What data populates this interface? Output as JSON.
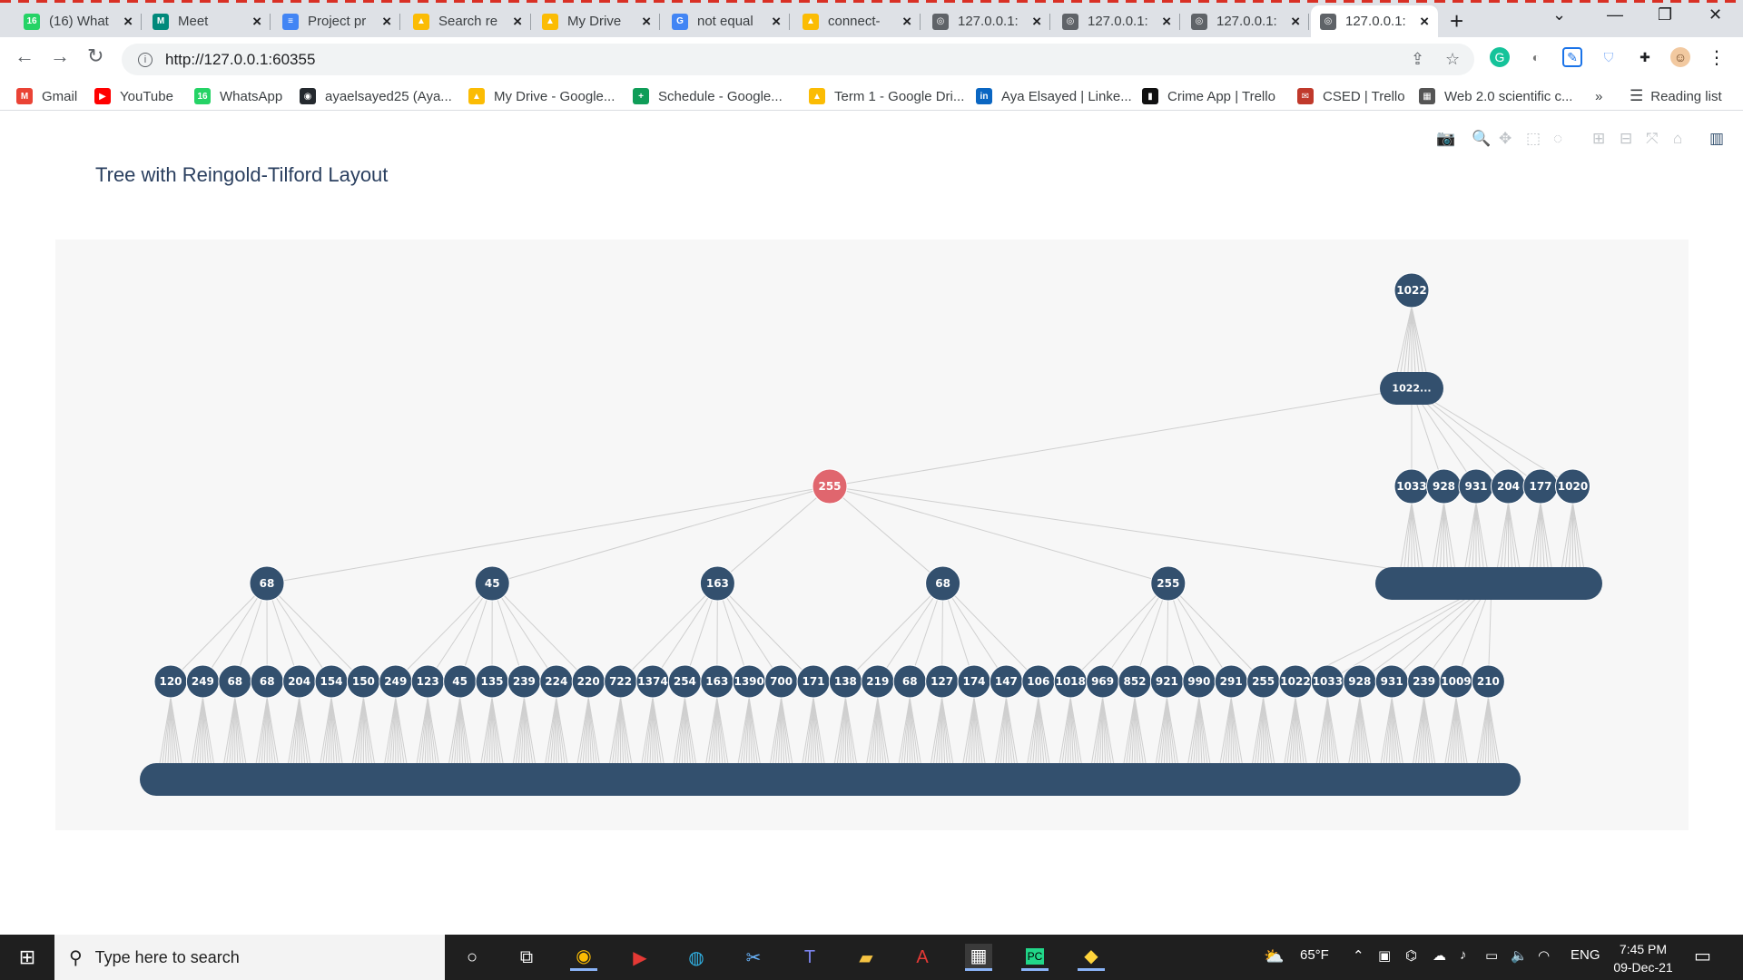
{
  "browser": {
    "tabs": [
      {
        "label": "(16) What",
        "color": "#25d366",
        "glyph": "16"
      },
      {
        "label": "Meet",
        "color": "#00897b",
        "glyph": "M"
      },
      {
        "label": "Project pr",
        "color": "#4285f4",
        "glyph": "≡"
      },
      {
        "label": "Search re",
        "color": "#fbbc04",
        "glyph": "▲"
      },
      {
        "label": "My Drive",
        "color": "#fbbc04",
        "glyph": "▲"
      },
      {
        "label": "not equal",
        "color": "#4285f4",
        "glyph": "G"
      },
      {
        "label": "connect-",
        "color": "#fbbc04",
        "glyph": "▲"
      },
      {
        "label": "127.0.0.1:",
        "color": "#5f6368",
        "glyph": "◎"
      },
      {
        "label": "127.0.0.1:",
        "color": "#5f6368",
        "glyph": "◎"
      },
      {
        "label": "127.0.0.1:",
        "color": "#5f6368",
        "glyph": "◎"
      },
      {
        "label": "127.0.0.1:",
        "color": "#5f6368",
        "glyph": "◎"
      }
    ],
    "url": "http://127.0.0.1:60355",
    "bookmarks": [
      {
        "label": "Gmail",
        "color": "#ea4335",
        "glyph": "M"
      },
      {
        "label": "YouTube",
        "color": "#ff0000",
        "glyph": "▶"
      },
      {
        "label": "WhatsApp",
        "color": "#25d366",
        "glyph": "16"
      },
      {
        "label": "ayaelsayed25 (Aya...",
        "color": "#24292e",
        "glyph": "◉"
      },
      {
        "label": "My Drive - Google...",
        "color": "#fbbc04",
        "glyph": "▲"
      },
      {
        "label": "Schedule - Google...",
        "color": "#0f9d58",
        "glyph": "+"
      },
      {
        "label": "Term 1 - Google Dri...",
        "color": "#fbbc04",
        "glyph": "▲"
      },
      {
        "label": "Aya Elsayed | Linke...",
        "color": "#0a66c2",
        "glyph": "in"
      },
      {
        "label": "Crime App | Trello",
        "color": "#111111",
        "glyph": "▮"
      },
      {
        "label": "CSED | Trello",
        "color": "#c0392b",
        "glyph": "✉"
      },
      {
        "label": "Web 2.0 scientific c...",
        "color": "#555555",
        "glyph": "▦"
      }
    ],
    "more": "»",
    "reading_list": "Reading list"
  },
  "plot": {
    "title": "Tree with Reingold-Tilford Layout",
    "root": {
      "label": "1022",
      "color": "#33506e"
    },
    "cluster_label": "1022... ",
    "center": {
      "label": "255",
      "color": "#e0666e"
    },
    "right_children": [
      "1033",
      "928",
      "931",
      "204",
      "177",
      "1020"
    ],
    "level3": [
      "68",
      "45",
      "163",
      "68",
      "255"
    ],
    "level4": [
      "120",
      "249",
      "68",
      "68",
      "204",
      "154",
      "150",
      "249",
      "123",
      "45",
      "135",
      "239",
      "224",
      "220",
      "722",
      "1374",
      "254",
      "163",
      "1390",
      "700",
      "171",
      "138",
      "219",
      "68",
      "127",
      "174",
      "147",
      "106",
      "1018",
      "969",
      "852",
      "921",
      "990",
      "291",
      "255",
      "1022",
      "1033",
      "928",
      "931",
      "239",
      "1009",
      "210"
    ],
    "node_color": "#33506e",
    "edge_color": "#cfcfcf"
  },
  "taskbar": {
    "search_placeholder": "Type here to search",
    "weather": "65°F",
    "lang": "ENG",
    "time": "7:45 PM",
    "date": "09-Dec-21"
  }
}
